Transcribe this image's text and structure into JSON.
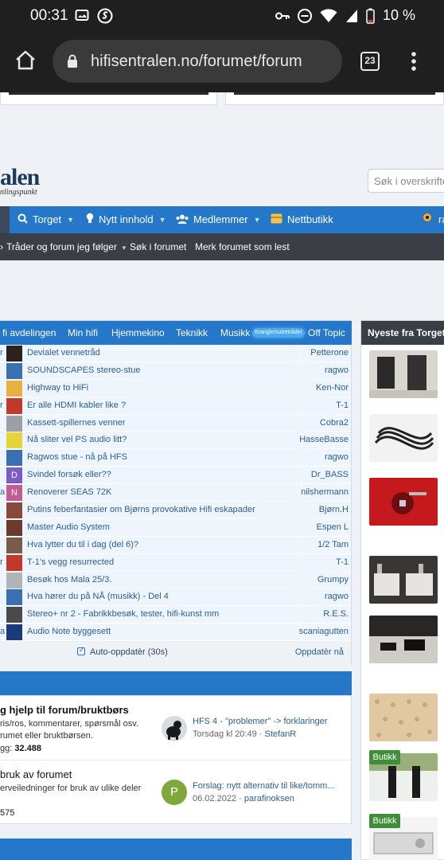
{
  "status_bar": {
    "time": "00:31",
    "battery": "10 %"
  },
  "browser": {
    "url": "hifisentralen.no/forumet/forum",
    "tab_count": "23"
  },
  "site": {
    "logo_text": "alen",
    "logo_sub": "nlingspunkt",
    "search_placeholder": "Søk i overskrifter"
  },
  "nav": {
    "items": [
      {
        "label": "Torget",
        "icon": "search-icon"
      },
      {
        "label": "Nytt innhold",
        "icon": "lightbulb-icon"
      },
      {
        "label": "Medlemmer",
        "icon": "users-icon"
      },
      {
        "label": "Nettbutikk",
        "icon": "shop-icon"
      },
      {
        "label": "ra",
        "icon": "user-avatar"
      }
    ]
  },
  "subnav": {
    "items": [
      {
        "label": "Tråder og forum jeg følger"
      },
      {
        "label": "Søk i forumet"
      },
      {
        "label": "Merk forumet som lest"
      }
    ]
  },
  "tabs": [
    {
      "label": "fi avdelingen"
    },
    {
      "label": "Min hifi"
    },
    {
      "label": "Hjemmekino"
    },
    {
      "label": "Teknikk"
    },
    {
      "label": "Musikk"
    },
    {
      "label": "Krangle/sutretråder"
    },
    {
      "label": "Off Topic"
    }
  ],
  "threads": [
    {
      "cut": "r",
      "title": "Devialet vennetråd",
      "user": "Petterone",
      "avatar_color": "#2b2220"
    },
    {
      "cut": "",
      "title": "SOUNDSCAPES stereo-stue",
      "user": "ragwo",
      "avatar_color": "#3a6fb0"
    },
    {
      "cut": "",
      "title": "Highway to HiFi",
      "user": "Ken-Nor",
      "avatar_color": "#e8b040"
    },
    {
      "cut": "r",
      "title": "Er alle HDMI kabler like ?",
      "user": "T-1",
      "avatar_color": "#c0392b"
    },
    {
      "cut": "",
      "title": "Kassett-spillernes venner",
      "user": "Cobra2",
      "avatar_color": "#9aa0a6"
    },
    {
      "cut": "",
      "title": "Nå sliter vel PS audio litt?",
      "user": "HasseBasse",
      "avatar_color": "#e6d43a"
    },
    {
      "cut": "",
      "title": "Ragwos stue - nå på HFS",
      "user": "ragwo",
      "avatar_color": "#3a6fb0"
    },
    {
      "cut": "",
      "title": "Svindel forsøk eller??",
      "user": "Dr_BASS",
      "avatar_color": "#7b5cc4",
      "letter": "D"
    },
    {
      "cut": "a",
      "title": "Renoverer SEAS 72K",
      "user": "nilshermann",
      "avatar_color": "#c45c94",
      "letter": "N"
    },
    {
      "cut": "",
      "title": "Putins feberfantasier om Bjørns provokative Hifi eskapader",
      "user": "Bjørn.H",
      "avatar_color": "#8a4a3a"
    },
    {
      "cut": "",
      "title": "Master Audio System",
      "user": "Espen L",
      "avatar_color": "#6b3a2a"
    },
    {
      "cut": "",
      "title": "Hva lytter du til i dag (del 6)?",
      "user": "1/2 Tam",
      "avatar_color": "#7a5a48"
    },
    {
      "cut": "r",
      "title": "T-1's vegg resurrected",
      "user": "T-1",
      "avatar_color": "#c0392b"
    },
    {
      "cut": "",
      "title": "Besøk hos Mala 25/3.",
      "user": "Grumpy",
      "avatar_color": "#b0b4b8"
    },
    {
      "cut": "",
      "title": "Hva hører du på NÅ (musikk) - Del 4",
      "user": "ragwo",
      "avatar_color": "#3a6fb0"
    },
    {
      "cut": "",
      "title": "Stereo+ nr 2 - Fabrikkbesøk, tester, hifi-kunst mm",
      "user": "R.E.S.",
      "avatar_color": "#4a4a4a"
    },
    {
      "cut": "a",
      "title": "Audio Note byggesett",
      "user": "scaniagutten",
      "avatar_color": "#1a3a7a"
    }
  ],
  "block_footer": {
    "auto_update": "Auto-oppdatèr (30s)",
    "update_now": "Oppdatèr nå"
  },
  "sidebar": {
    "title": "Nyeste fra Torget",
    "badges": [
      "Butikk",
      "Butikk"
    ]
  },
  "nodes": [
    {
      "title": "g hjelp til forum/bruktbørs",
      "desc_line1": "ris/ros, kommentarer, spørsmål osv.",
      "desc_line2": "rumet eller bruktbørsen.",
      "stat_label": "gg:",
      "stat_value": "32.488",
      "last_title": "HFS 4 - \"problemer\" -> forklaringer",
      "last_date": "Torsdag kl 20:49",
      "last_user": "StefanR"
    },
    {
      "title": "bruk av forumet",
      "desc_line1": "erveiledninger for bruk av ulike deler",
      "stat_value": "575",
      "last_title": "Forslag: nytt alternativ til like/tomm...",
      "last_date": "06.02.2022",
      "last_user": "parafinoksen",
      "avatar_letter": "P"
    }
  ]
}
